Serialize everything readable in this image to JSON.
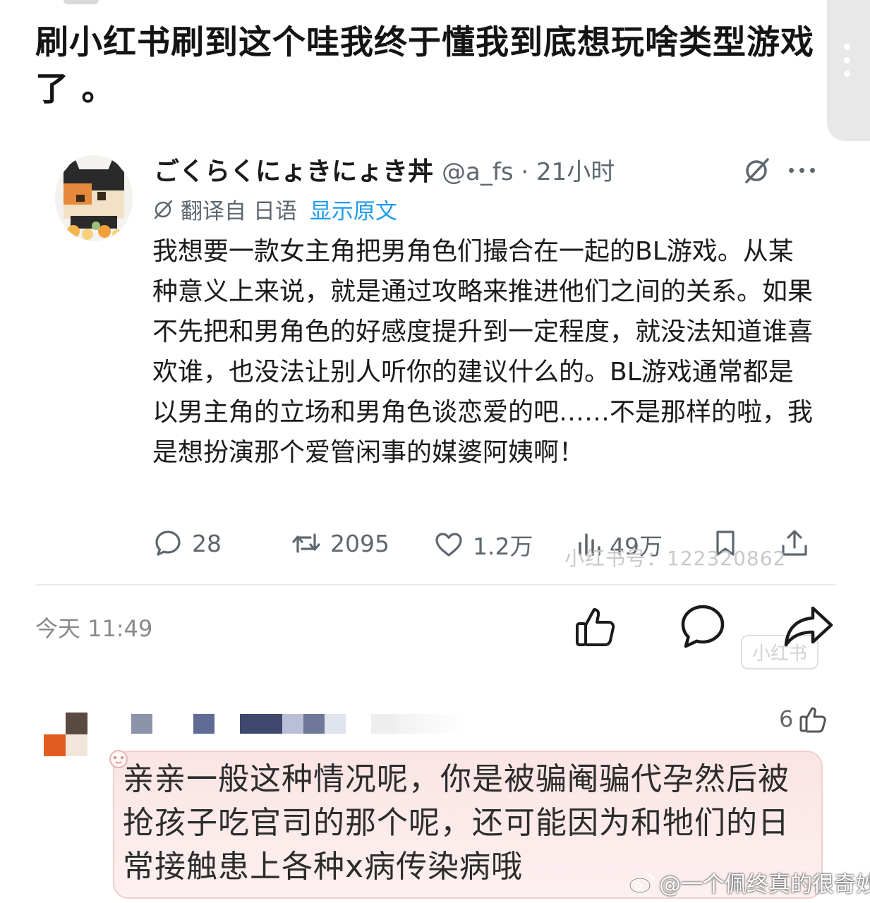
{
  "post": {
    "title": "刷小红书刷到这个哇我终于懂我到底想玩啥类型游戏了 。"
  },
  "quoted_tweet": {
    "author_name": "ごくらくにょきにょき丼",
    "author_meta": "@a_fs · 21小时",
    "translate_label": "翻译自 日语",
    "show_original": "显示原文",
    "body": "我想要一款女主角把男角色们撮合在一起的BL游戏。从某种意义上来说，就是通过攻略来推进他们之间的关系。如果不先把和男角色的好感度提升到一定程度，就没法知道谁喜欢谁，也没法让别人听你的建议什么的。BL游戏通常都是以男主角的立场和男角色谈恋爱的吧……不是那样的啦，我是想扮演那个爱管闲事的媒婆阿姨啊！",
    "stats": {
      "replies": "28",
      "retweets": "2095",
      "likes": "1.2万",
      "views": "49万"
    },
    "faint_watermark": "小红书号：122320862",
    "stamp_watermark": "小红书"
  },
  "bottom_bar": {
    "timestamp": "今天 11:49"
  },
  "comment": {
    "like_count": "6",
    "text": "亲亲一般这种情况呢，你是被骗阉骗代孕然后被抢孩子吃官司的那个呢，还可能因为和牠们的日常接触患上各种x病传染病哦"
  },
  "watermark": {
    "weibo": "@一个佩终真的很奇妙"
  },
  "colors": {
    "link_blue": "#1d9bf0",
    "meta_gray": "#5d6770",
    "bubble_pink": "#fbe4e4",
    "avatar_orange": "#e25c1f"
  },
  "icons": [
    "more-vertical-icon",
    "grok-icon",
    "more-horizontal-icon",
    "translate-icon",
    "reply-icon",
    "retweet-icon",
    "heart-icon",
    "views-icon",
    "bookmark-icon",
    "share-icon",
    "thumbs-up-icon",
    "comment-icon",
    "forward-icon",
    "weibo-logo-icon"
  ]
}
